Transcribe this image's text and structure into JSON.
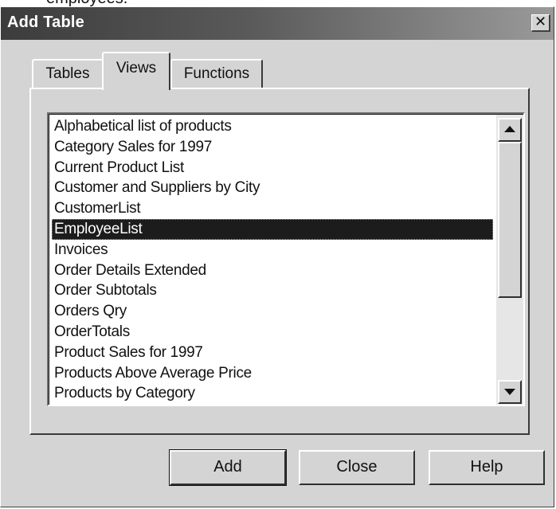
{
  "top_fragment": "employees.",
  "window": {
    "title": "Add Table",
    "close_glyph": "✕"
  },
  "tabs": [
    {
      "label": "Tables",
      "active": false
    },
    {
      "label": "Views",
      "active": true
    },
    {
      "label": "Functions",
      "active": false
    }
  ],
  "list": {
    "items": [
      "Alphabetical list of products",
      "Category Sales for 1997",
      "Current Product List",
      "Customer and Suppliers by City",
      "CustomerList",
      "EmployeeList",
      "Invoices",
      "Order Details Extended",
      "Order Subtotals",
      "Orders Qry",
      "OrderTotals",
      "Product Sales for 1997",
      "Products Above Average Price",
      "Products by Category"
    ],
    "selected_index": 5,
    "scrollbar": {
      "up_icon": "arrow-up-icon",
      "down_icon": "arrow-down-icon"
    }
  },
  "buttons": {
    "add": "Add",
    "close": "Close",
    "help": "Help"
  },
  "colors": {
    "dialog_bg": "#d4d4d4",
    "selection_bg": "#1c1c1c",
    "selection_fg": "#ffffff"
  }
}
